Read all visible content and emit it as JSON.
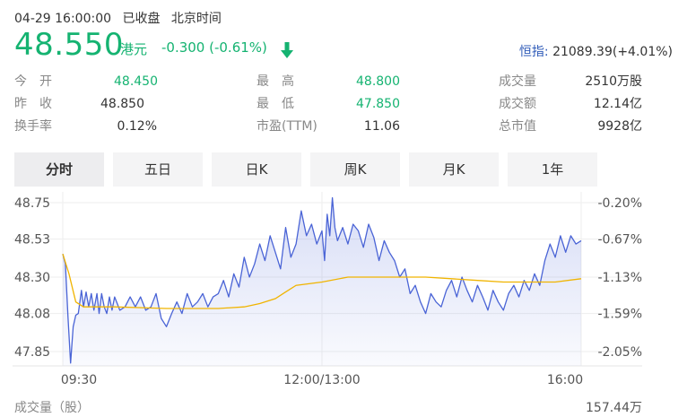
{
  "status": {
    "datetime": "04-29 16:00:00",
    "market_state": "已收盘",
    "timezone": "北京时间"
  },
  "quote": {
    "price": "48.550",
    "currency": "港元",
    "change": "-0.300 (-0.61%)",
    "down_color": "#15b371",
    "index_name": "恒指:",
    "index_value": "21089.39(+4.01%)"
  },
  "stats": [
    {
      "label": "今　开",
      "value": "48.450",
      "tone": "green"
    },
    {
      "label": "最　高",
      "value": "48.800",
      "tone": "green"
    },
    {
      "label": "成交量",
      "value": "2510万股",
      "tone": "dark"
    },
    {
      "label": "昨　收",
      "value": "48.850",
      "tone": "dark"
    },
    {
      "label": "最　低",
      "value": "47.850",
      "tone": "green"
    },
    {
      "label": "成交额",
      "value": "12.14亿",
      "tone": "dark"
    },
    {
      "label": "换手率",
      "value": "0.12%",
      "tone": "dark"
    },
    {
      "label": "市盈(TTM)",
      "value": "11.06",
      "tone": "dark"
    },
    {
      "label": "总市值",
      "value": "9928亿",
      "tone": "dark"
    }
  ],
  "tabs": [
    {
      "label": "分时",
      "active": true
    },
    {
      "label": "五日",
      "active": false
    },
    {
      "label": "日K",
      "active": false
    },
    {
      "label": "周K",
      "active": false
    },
    {
      "label": "月K",
      "active": false
    },
    {
      "label": "1年",
      "active": false
    }
  ],
  "chart_data": {
    "type": "line",
    "y_ticks": [
      "48.75",
      "48.53",
      "48.30",
      "48.08",
      "47.85"
    ],
    "y_tick_values": [
      48.75,
      48.53,
      48.3,
      48.08,
      47.85
    ],
    "pct_ticks": [
      "-0.20%",
      "-0.67%",
      "-1.13%",
      "-1.59%",
      "-2.05%"
    ],
    "x_ticks": [
      "09:30",
      "12:00/13:00",
      "16:00"
    ],
    "x_tick_positions": [
      0,
      0.5,
      1
    ],
    "ylim": [
      47.85,
      48.75
    ],
    "line_color": "#4a64d6",
    "avg_color": "#f0b400",
    "series": [
      {
        "kind": "price",
        "x": [
          0.0,
          0.005,
          0.01,
          0.015,
          0.02,
          0.025,
          0.03,
          0.036,
          0.04,
          0.045,
          0.05,
          0.055,
          0.06,
          0.066,
          0.07,
          0.075,
          0.08,
          0.085,
          0.09,
          0.095,
          0.1,
          0.11,
          0.12,
          0.13,
          0.14,
          0.15,
          0.16,
          0.17,
          0.18,
          0.19,
          0.2,
          0.21,
          0.22,
          0.23,
          0.24,
          0.25,
          0.26,
          0.27,
          0.28,
          0.29,
          0.3,
          0.31,
          0.32,
          0.33,
          0.34,
          0.35,
          0.36,
          0.37,
          0.38,
          0.39,
          0.4,
          0.41,
          0.42,
          0.43,
          0.44,
          0.45,
          0.46,
          0.47,
          0.48,
          0.49,
          0.5,
          0.505,
          0.51,
          0.515,
          0.52,
          0.525,
          0.53,
          0.54,
          0.55,
          0.56,
          0.57,
          0.58,
          0.59,
          0.6,
          0.61,
          0.62,
          0.63,
          0.64,
          0.65,
          0.66,
          0.67,
          0.68,
          0.69,
          0.7,
          0.71,
          0.72,
          0.73,
          0.74,
          0.75,
          0.76,
          0.77,
          0.78,
          0.79,
          0.8,
          0.81,
          0.82,
          0.83,
          0.84,
          0.85,
          0.86,
          0.87,
          0.88,
          0.89,
          0.9,
          0.91,
          0.92,
          0.93,
          0.94,
          0.95,
          0.96,
          0.97,
          0.98,
          0.99,
          1.0
        ],
        "values": [
          48.44,
          48.38,
          48.06,
          47.78,
          48.0,
          48.07,
          48.08,
          48.22,
          48.12,
          48.21,
          48.12,
          48.2,
          48.1,
          48.2,
          48.08,
          48.2,
          48.12,
          48.08,
          48.18,
          48.1,
          48.18,
          48.1,
          48.12,
          48.18,
          48.12,
          48.18,
          48.1,
          48.12,
          48.2,
          48.05,
          48.0,
          48.08,
          48.15,
          48.08,
          48.2,
          48.12,
          48.15,
          48.2,
          48.12,
          48.18,
          48.2,
          48.28,
          48.18,
          48.32,
          48.24,
          48.42,
          48.3,
          48.38,
          48.5,
          48.4,
          48.55,
          48.45,
          48.35,
          48.6,
          48.42,
          48.5,
          48.7,
          48.55,
          48.62,
          48.5,
          48.58,
          48.4,
          48.68,
          48.55,
          48.78,
          48.6,
          48.52,
          48.6,
          48.5,
          48.62,
          48.58,
          48.48,
          48.62,
          48.54,
          48.4,
          48.52,
          48.45,
          48.4,
          48.3,
          48.35,
          48.2,
          48.25,
          48.15,
          48.08,
          48.2,
          48.15,
          48.12,
          48.22,
          48.28,
          48.18,
          48.3,
          48.22,
          48.15,
          48.25,
          48.18,
          48.1,
          48.22,
          48.15,
          48.1,
          48.2,
          48.25,
          48.18,
          48.28,
          48.22,
          48.32,
          48.25,
          48.4,
          48.5,
          48.42,
          48.55,
          48.45,
          48.55,
          48.5,
          48.52
        ],
        "name": ""
      },
      {
        "kind": "average",
        "x": [
          0.0,
          0.012,
          0.025,
          0.04,
          0.06,
          0.1,
          0.2,
          0.3,
          0.35,
          0.38,
          0.41,
          0.43,
          0.45,
          0.5,
          0.55,
          0.6,
          0.65,
          0.7,
          0.75,
          0.8,
          0.85,
          0.9,
          0.95,
          1.0
        ],
        "values": [
          48.44,
          48.32,
          48.15,
          48.12,
          48.12,
          48.12,
          48.11,
          48.11,
          48.12,
          48.14,
          48.17,
          48.21,
          48.25,
          48.27,
          48.3,
          48.3,
          48.3,
          48.3,
          48.29,
          48.28,
          48.27,
          48.27,
          48.27,
          48.29
        ],
        "name": ""
      }
    ],
    "volume_label": "成交量（股）",
    "volume_value": "157.44万"
  }
}
